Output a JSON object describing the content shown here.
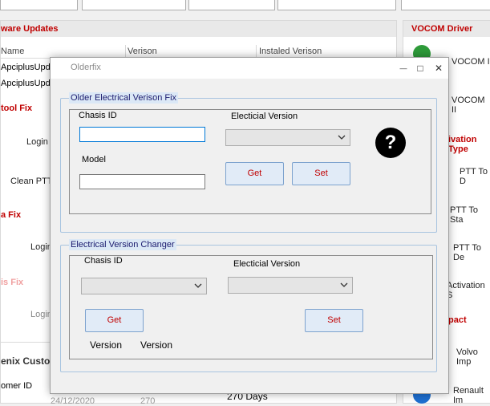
{
  "background": {
    "software_updates": {
      "title": "ware Updates",
      "columns": [
        "Name",
        "Verison",
        "Instaled Verison"
      ],
      "rows": [
        [
          "ApciplusUpda"
        ],
        [
          "ApciplusUpda"
        ]
      ]
    },
    "tool_fix": {
      "title": "tool Fix",
      "login": "Login",
      "clean_ptt": "Clean PTT"
    },
    "a_fix": {
      "title": "a Fix",
      "login": "Login"
    },
    "is_fix": {
      "title": "is Fix",
      "login": "Login"
    },
    "custom": {
      "title": "enix Custom",
      "customer_id_label": "omer ID",
      "date_value": "24/12/2020",
      "num_value": "270",
      "days": "270 Days"
    },
    "vocom": {
      "title": "VOCOM Driver",
      "item1": "VOCOM I",
      "item2": "VOCOM II"
    },
    "activation": {
      "title": "ivation Type",
      "items": [
        "PTT To D",
        "PTT To Sta",
        "PTT To De",
        "Activation S"
      ]
    },
    "impact": {
      "title": "pact",
      "items": [
        "Volvo Imp",
        "Renault Im"
      ]
    }
  },
  "dialog": {
    "title": "Olderfix",
    "controls": {
      "minimize": "—",
      "maximize": "□",
      "close": "✕"
    },
    "older_fix": {
      "group_title": "Older  Electrical  Verison Fix",
      "chassis_label": "Chasis ID",
      "chassis_value": "",
      "model_label": "Model",
      "model_value": "",
      "version_label": "Electicial Version",
      "version_selected": "",
      "get_label": "Get",
      "set_label": "Set",
      "help": "?"
    },
    "changer": {
      "group_title": "Electrical  Version Changer",
      "chassis_label": "Chasis ID",
      "chassis_selected": "",
      "version_label": "Electicial Version",
      "version_selected": "",
      "get_label": "Get",
      "set_label": "Set",
      "version_text_1": "Version",
      "version_text_2": "Version"
    }
  }
}
